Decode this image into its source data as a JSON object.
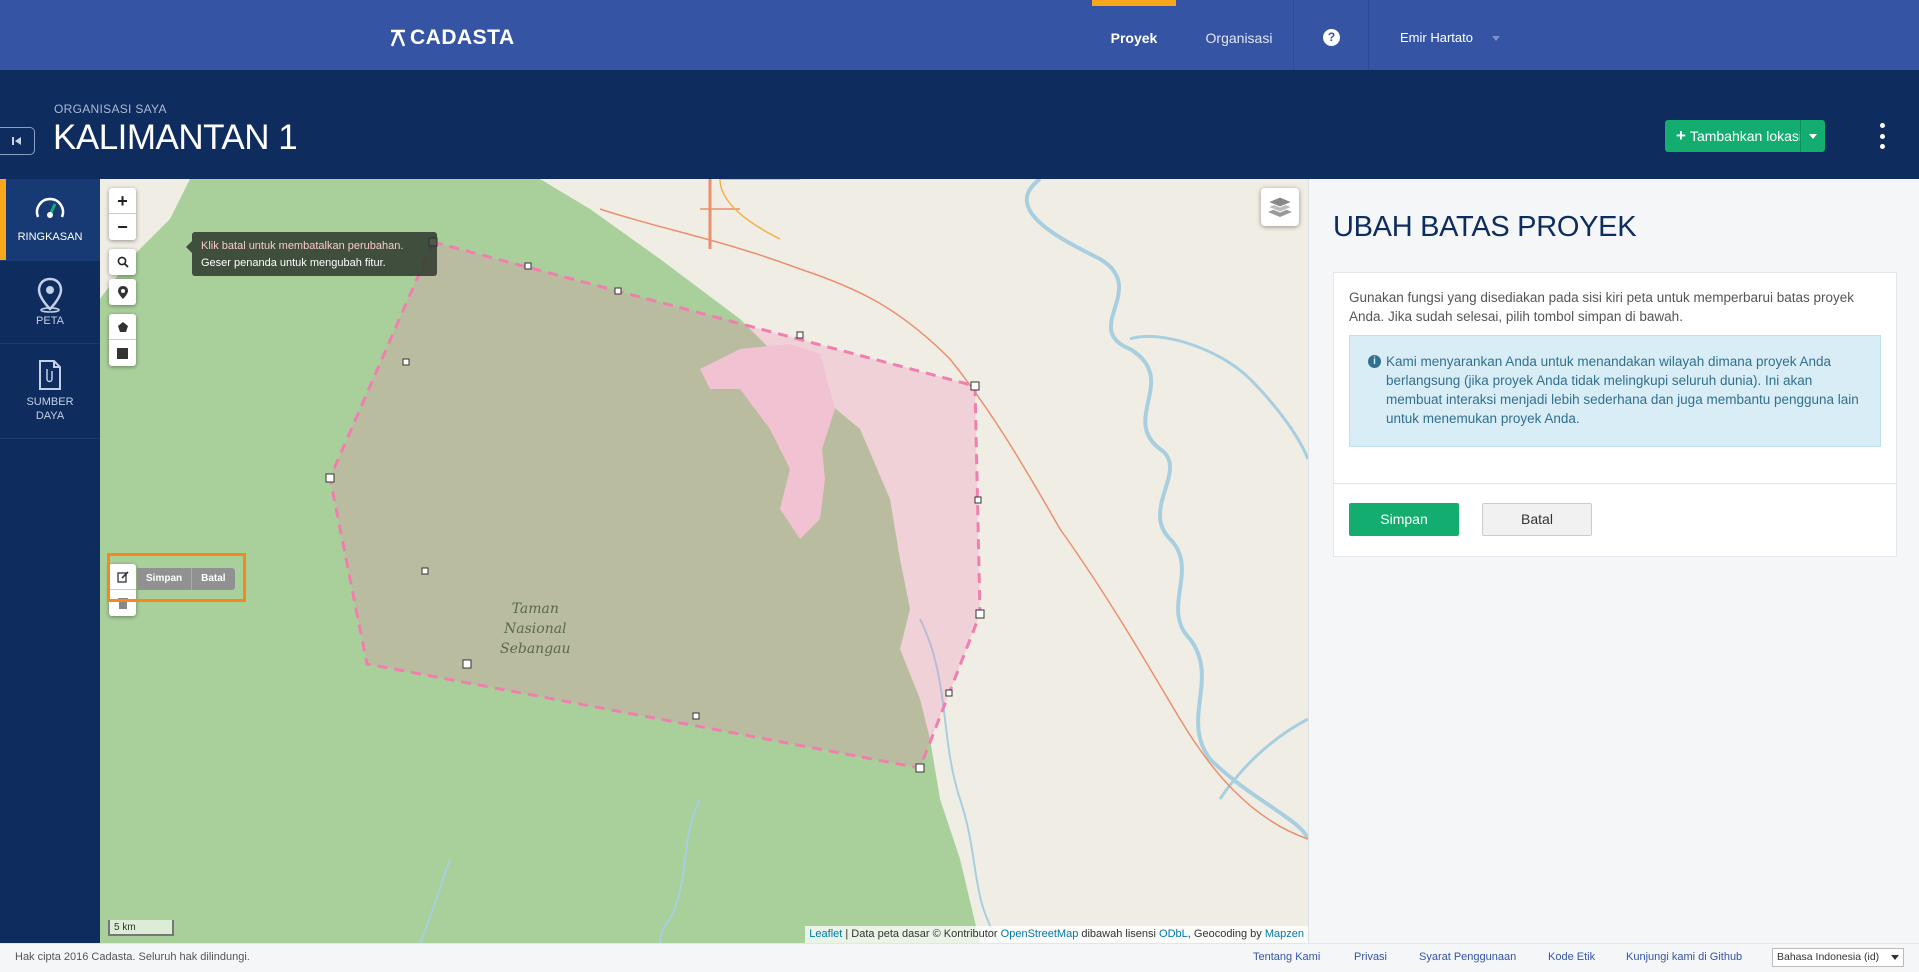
{
  "brand": {
    "name": "CADASTA"
  },
  "topnav": {
    "items": [
      {
        "label": "Proyek",
        "active": true
      },
      {
        "label": "Organisasi",
        "active": false
      }
    ],
    "help_icon": "question-circle-icon",
    "user_name": "Emir Hartato"
  },
  "header": {
    "org_label": "ORGANISASI SAYA",
    "project_title": "KALIMANTAN 1",
    "add_location_label": "Tambahkan lokasi"
  },
  "sidebar": {
    "items": [
      {
        "label": "RINGKASAN",
        "icon": "dashboard-icon",
        "active": true
      },
      {
        "label": "PETA",
        "icon": "map-pin-icon",
        "active": false
      },
      {
        "label": "SUMBER DAYA",
        "label_line1": "SUMBER",
        "label_line2": "DAYA",
        "icon": "document-icon",
        "active": false
      }
    ]
  },
  "map": {
    "tooltip_line1": "Klik batal untuk membatalkan perubahan.",
    "tooltip_line2": "Geser penanda untuk mengubah fitur.",
    "edit_save": "Simpan",
    "edit_cancel": "Batal",
    "place_label_1": "Taman",
    "place_label_2": "Nasional",
    "place_label_3": "Sebangau",
    "scale": "5 km",
    "attribution": {
      "leaflet": "Leaflet",
      "text1": "| Data peta dasar © Kontributor",
      "osm": "OpenStreetMap",
      "text2": "dibawah lisensi",
      "odbl": "ODbL",
      "text3": ", Geocoding by",
      "mapzen": "Mapzen"
    },
    "colors": {
      "park": "#a9d09a",
      "boundary": "#f07fb0",
      "river": "#a8cfe0",
      "road": "#e9906e"
    }
  },
  "panel": {
    "title": "UBAH BATAS PROYEK",
    "intro": "Gunakan fungsi yang disediakan pada sisi kiri peta untuk memperbarui batas proyek Anda. Jika sudah selesai, pilih tombol simpan di bawah.",
    "info": "Kami menyarankan Anda untuk menandakan wilayah dimana proyek Anda berlangsung (jika proyek Anda tidak melingkupi seluruh dunia). Ini akan membuat interaksi menjadi lebih sederhana dan juga membantu pengguna lain untuk menemukan proyek Anda.",
    "save_label": "Simpan",
    "cancel_label": "Batal"
  },
  "footer": {
    "copyright": "Hak cipta 2016 Cadasta. Seluruh hak dilindungi.",
    "links": [
      "Tentang Kami",
      "Privasi",
      "Syarat Penggunaan",
      "Kode Etik",
      "Kunjungi kami di Github"
    ],
    "language": "Bahasa Indonesia (id)"
  }
}
